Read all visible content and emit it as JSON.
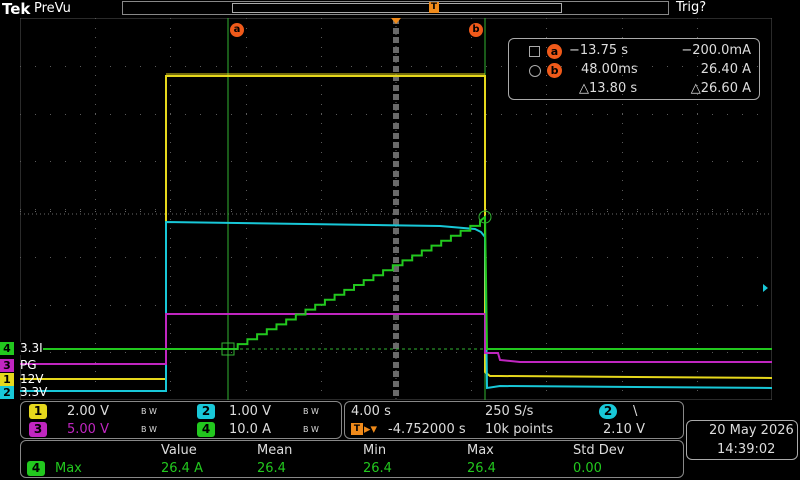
{
  "header": {
    "logo": "Tek",
    "mode": "PreVu",
    "trigger_status": "Trig?",
    "trigger_marker": "T"
  },
  "cursors": {
    "a_label": "a",
    "b_label": "b"
  },
  "readout": {
    "a_time": "−13.75 s",
    "a_value": "−200.0mA",
    "b_time": "48.00ms",
    "b_value": "26.40 A",
    "delta_time": "△13.80 s",
    "delta_value": "△26.60 A"
  },
  "channels": [
    {
      "num": "4",
      "label": "3.3I",
      "color": "#22c81e"
    },
    {
      "num": "3",
      "label": "PG",
      "color": "#c026c0"
    },
    {
      "num": "1",
      "label": "12V",
      "color": "#e6d81c"
    },
    {
      "num": "2",
      "label": "3.3V",
      "color": "#18c8d8"
    }
  ],
  "scales": {
    "ch1": "2.00 V",
    "ch2": "1.00 V",
    "ch3": "5.00 V",
    "ch4": "10.0 A",
    "bw": "B W"
  },
  "timebase": {
    "horizontal": "4.00 s",
    "sample_rate": "250 S/s",
    "position": "-4.752000 s",
    "record_length": "10k points",
    "trigger_channel": "2",
    "trigger_slope": "\\",
    "trigger_level": "2.10 V"
  },
  "datetime": {
    "date": "20 May  2026",
    "time": "14:39:02"
  },
  "measurement": {
    "headers": [
      "Value",
      "Mean",
      "Min",
      "Max",
      "Std Dev"
    ],
    "channel": "4",
    "name": "Max",
    "values": [
      "26.4 A",
      "26.4",
      "26.4",
      "26.4",
      "0.00"
    ]
  }
}
